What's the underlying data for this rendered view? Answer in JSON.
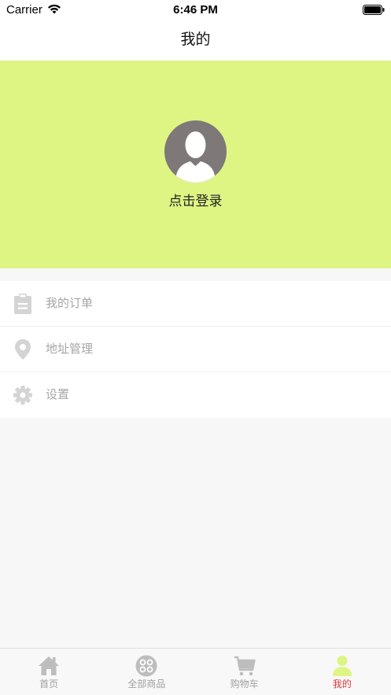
{
  "status_bar": {
    "carrier": "Carrier",
    "time": "6:46 PM"
  },
  "nav": {
    "title": "我的"
  },
  "profile": {
    "login_text": "点击登录",
    "background_color": "#def584",
    "avatar_icon": "user-silhouette-icon"
  },
  "menu": {
    "items": [
      {
        "label": "我的订单",
        "icon": "clipboard-icon"
      },
      {
        "label": "地址管理",
        "icon": "location-pin-icon"
      },
      {
        "label": "设置",
        "icon": "gear-icon"
      }
    ]
  },
  "tab_bar": {
    "active_color": "#e03b3b",
    "items": [
      {
        "label": "首页",
        "icon": "home-icon"
      },
      {
        "label": "全部商品",
        "icon": "grid-dots-icon"
      },
      {
        "label": "购物车",
        "icon": "cart-icon"
      },
      {
        "label": "我的",
        "icon": "person-icon",
        "active": true
      }
    ]
  }
}
